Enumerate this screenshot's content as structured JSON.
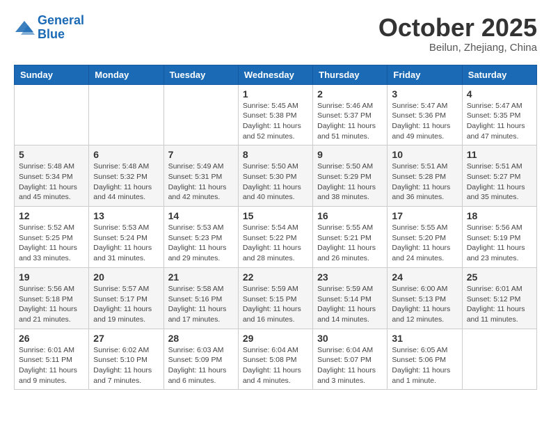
{
  "logo": {
    "line1": "General",
    "line2": "Blue"
  },
  "header": {
    "month": "October 2025",
    "location": "Beilun, Zhejiang, China"
  },
  "weekdays": [
    "Sunday",
    "Monday",
    "Tuesday",
    "Wednesday",
    "Thursday",
    "Friday",
    "Saturday"
  ],
  "weeks": [
    [
      {
        "day": "",
        "info": ""
      },
      {
        "day": "",
        "info": ""
      },
      {
        "day": "",
        "info": ""
      },
      {
        "day": "1",
        "info": "Sunrise: 5:45 AM\nSunset: 5:38 PM\nDaylight: 11 hours\nand 52 minutes."
      },
      {
        "day": "2",
        "info": "Sunrise: 5:46 AM\nSunset: 5:37 PM\nDaylight: 11 hours\nand 51 minutes."
      },
      {
        "day": "3",
        "info": "Sunrise: 5:47 AM\nSunset: 5:36 PM\nDaylight: 11 hours\nand 49 minutes."
      },
      {
        "day": "4",
        "info": "Sunrise: 5:47 AM\nSunset: 5:35 PM\nDaylight: 11 hours\nand 47 minutes."
      }
    ],
    [
      {
        "day": "5",
        "info": "Sunrise: 5:48 AM\nSunset: 5:34 PM\nDaylight: 11 hours\nand 45 minutes."
      },
      {
        "day": "6",
        "info": "Sunrise: 5:48 AM\nSunset: 5:32 PM\nDaylight: 11 hours\nand 44 minutes."
      },
      {
        "day": "7",
        "info": "Sunrise: 5:49 AM\nSunset: 5:31 PM\nDaylight: 11 hours\nand 42 minutes."
      },
      {
        "day": "8",
        "info": "Sunrise: 5:50 AM\nSunset: 5:30 PM\nDaylight: 11 hours\nand 40 minutes."
      },
      {
        "day": "9",
        "info": "Sunrise: 5:50 AM\nSunset: 5:29 PM\nDaylight: 11 hours\nand 38 minutes."
      },
      {
        "day": "10",
        "info": "Sunrise: 5:51 AM\nSunset: 5:28 PM\nDaylight: 11 hours\nand 36 minutes."
      },
      {
        "day": "11",
        "info": "Sunrise: 5:51 AM\nSunset: 5:27 PM\nDaylight: 11 hours\nand 35 minutes."
      }
    ],
    [
      {
        "day": "12",
        "info": "Sunrise: 5:52 AM\nSunset: 5:25 PM\nDaylight: 11 hours\nand 33 minutes."
      },
      {
        "day": "13",
        "info": "Sunrise: 5:53 AM\nSunset: 5:24 PM\nDaylight: 11 hours\nand 31 minutes."
      },
      {
        "day": "14",
        "info": "Sunrise: 5:53 AM\nSunset: 5:23 PM\nDaylight: 11 hours\nand 29 minutes."
      },
      {
        "day": "15",
        "info": "Sunrise: 5:54 AM\nSunset: 5:22 PM\nDaylight: 11 hours\nand 28 minutes."
      },
      {
        "day": "16",
        "info": "Sunrise: 5:55 AM\nSunset: 5:21 PM\nDaylight: 11 hours\nand 26 minutes."
      },
      {
        "day": "17",
        "info": "Sunrise: 5:55 AM\nSunset: 5:20 PM\nDaylight: 11 hours\nand 24 minutes."
      },
      {
        "day": "18",
        "info": "Sunrise: 5:56 AM\nSunset: 5:19 PM\nDaylight: 11 hours\nand 23 minutes."
      }
    ],
    [
      {
        "day": "19",
        "info": "Sunrise: 5:56 AM\nSunset: 5:18 PM\nDaylight: 11 hours\nand 21 minutes."
      },
      {
        "day": "20",
        "info": "Sunrise: 5:57 AM\nSunset: 5:17 PM\nDaylight: 11 hours\nand 19 minutes."
      },
      {
        "day": "21",
        "info": "Sunrise: 5:58 AM\nSunset: 5:16 PM\nDaylight: 11 hours\nand 17 minutes."
      },
      {
        "day": "22",
        "info": "Sunrise: 5:59 AM\nSunset: 5:15 PM\nDaylight: 11 hours\nand 16 minutes."
      },
      {
        "day": "23",
        "info": "Sunrise: 5:59 AM\nSunset: 5:14 PM\nDaylight: 11 hours\nand 14 minutes."
      },
      {
        "day": "24",
        "info": "Sunrise: 6:00 AM\nSunset: 5:13 PM\nDaylight: 11 hours\nand 12 minutes."
      },
      {
        "day": "25",
        "info": "Sunrise: 6:01 AM\nSunset: 5:12 PM\nDaylight: 11 hours\nand 11 minutes."
      }
    ],
    [
      {
        "day": "26",
        "info": "Sunrise: 6:01 AM\nSunset: 5:11 PM\nDaylight: 11 hours\nand 9 minutes."
      },
      {
        "day": "27",
        "info": "Sunrise: 6:02 AM\nSunset: 5:10 PM\nDaylight: 11 hours\nand 7 minutes."
      },
      {
        "day": "28",
        "info": "Sunrise: 6:03 AM\nSunset: 5:09 PM\nDaylight: 11 hours\nand 6 minutes."
      },
      {
        "day": "29",
        "info": "Sunrise: 6:04 AM\nSunset: 5:08 PM\nDaylight: 11 hours\nand 4 minutes."
      },
      {
        "day": "30",
        "info": "Sunrise: 6:04 AM\nSunset: 5:07 PM\nDaylight: 11 hours\nand 3 minutes."
      },
      {
        "day": "31",
        "info": "Sunrise: 6:05 AM\nSunset: 5:06 PM\nDaylight: 11 hours\nand 1 minute."
      },
      {
        "day": "",
        "info": ""
      }
    ]
  ]
}
